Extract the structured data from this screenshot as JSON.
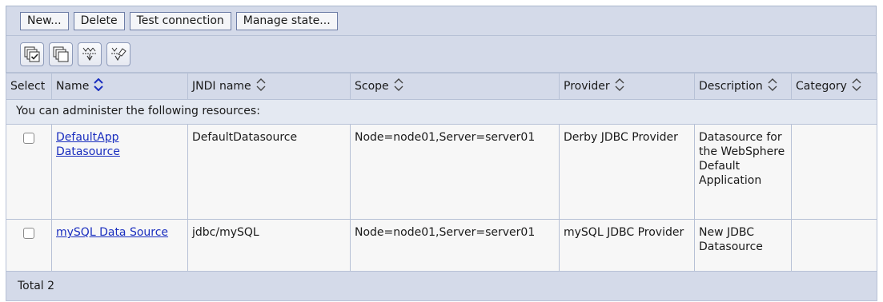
{
  "toolbar": {
    "buttons": [
      "New...",
      "Delete",
      "Test connection",
      "Manage state..."
    ],
    "icons": [
      "select-all-icon",
      "deselect-all-icon",
      "expand-filter-icon",
      "clear-filter-icon"
    ]
  },
  "table": {
    "headers": [
      "Select",
      "Name",
      "JNDI name",
      "Scope",
      "Provider",
      "Description",
      "Category"
    ],
    "info": "You can administer the following resources:",
    "rows": [
      {
        "name": "DefaultApp Datasource",
        "jndi": "DefaultDatasource",
        "scope": "Node=node01,Server=server01",
        "provider": "Derby JDBC Provider",
        "description": "Datasource for the WebSphere Default Application",
        "category": ""
      },
      {
        "name": "mySQL Data Source",
        "jndi": "jdbc/mySQL",
        "scope": "Node=node01,Server=server01",
        "provider": "mySQL JDBC Provider",
        "description": "New JDBC Datasource",
        "category": ""
      }
    ],
    "footer": "Total 2"
  },
  "colors": {
    "header_bg": "#d4dae9",
    "link": "#1a2ebf",
    "border": "#b7c1d6"
  }
}
